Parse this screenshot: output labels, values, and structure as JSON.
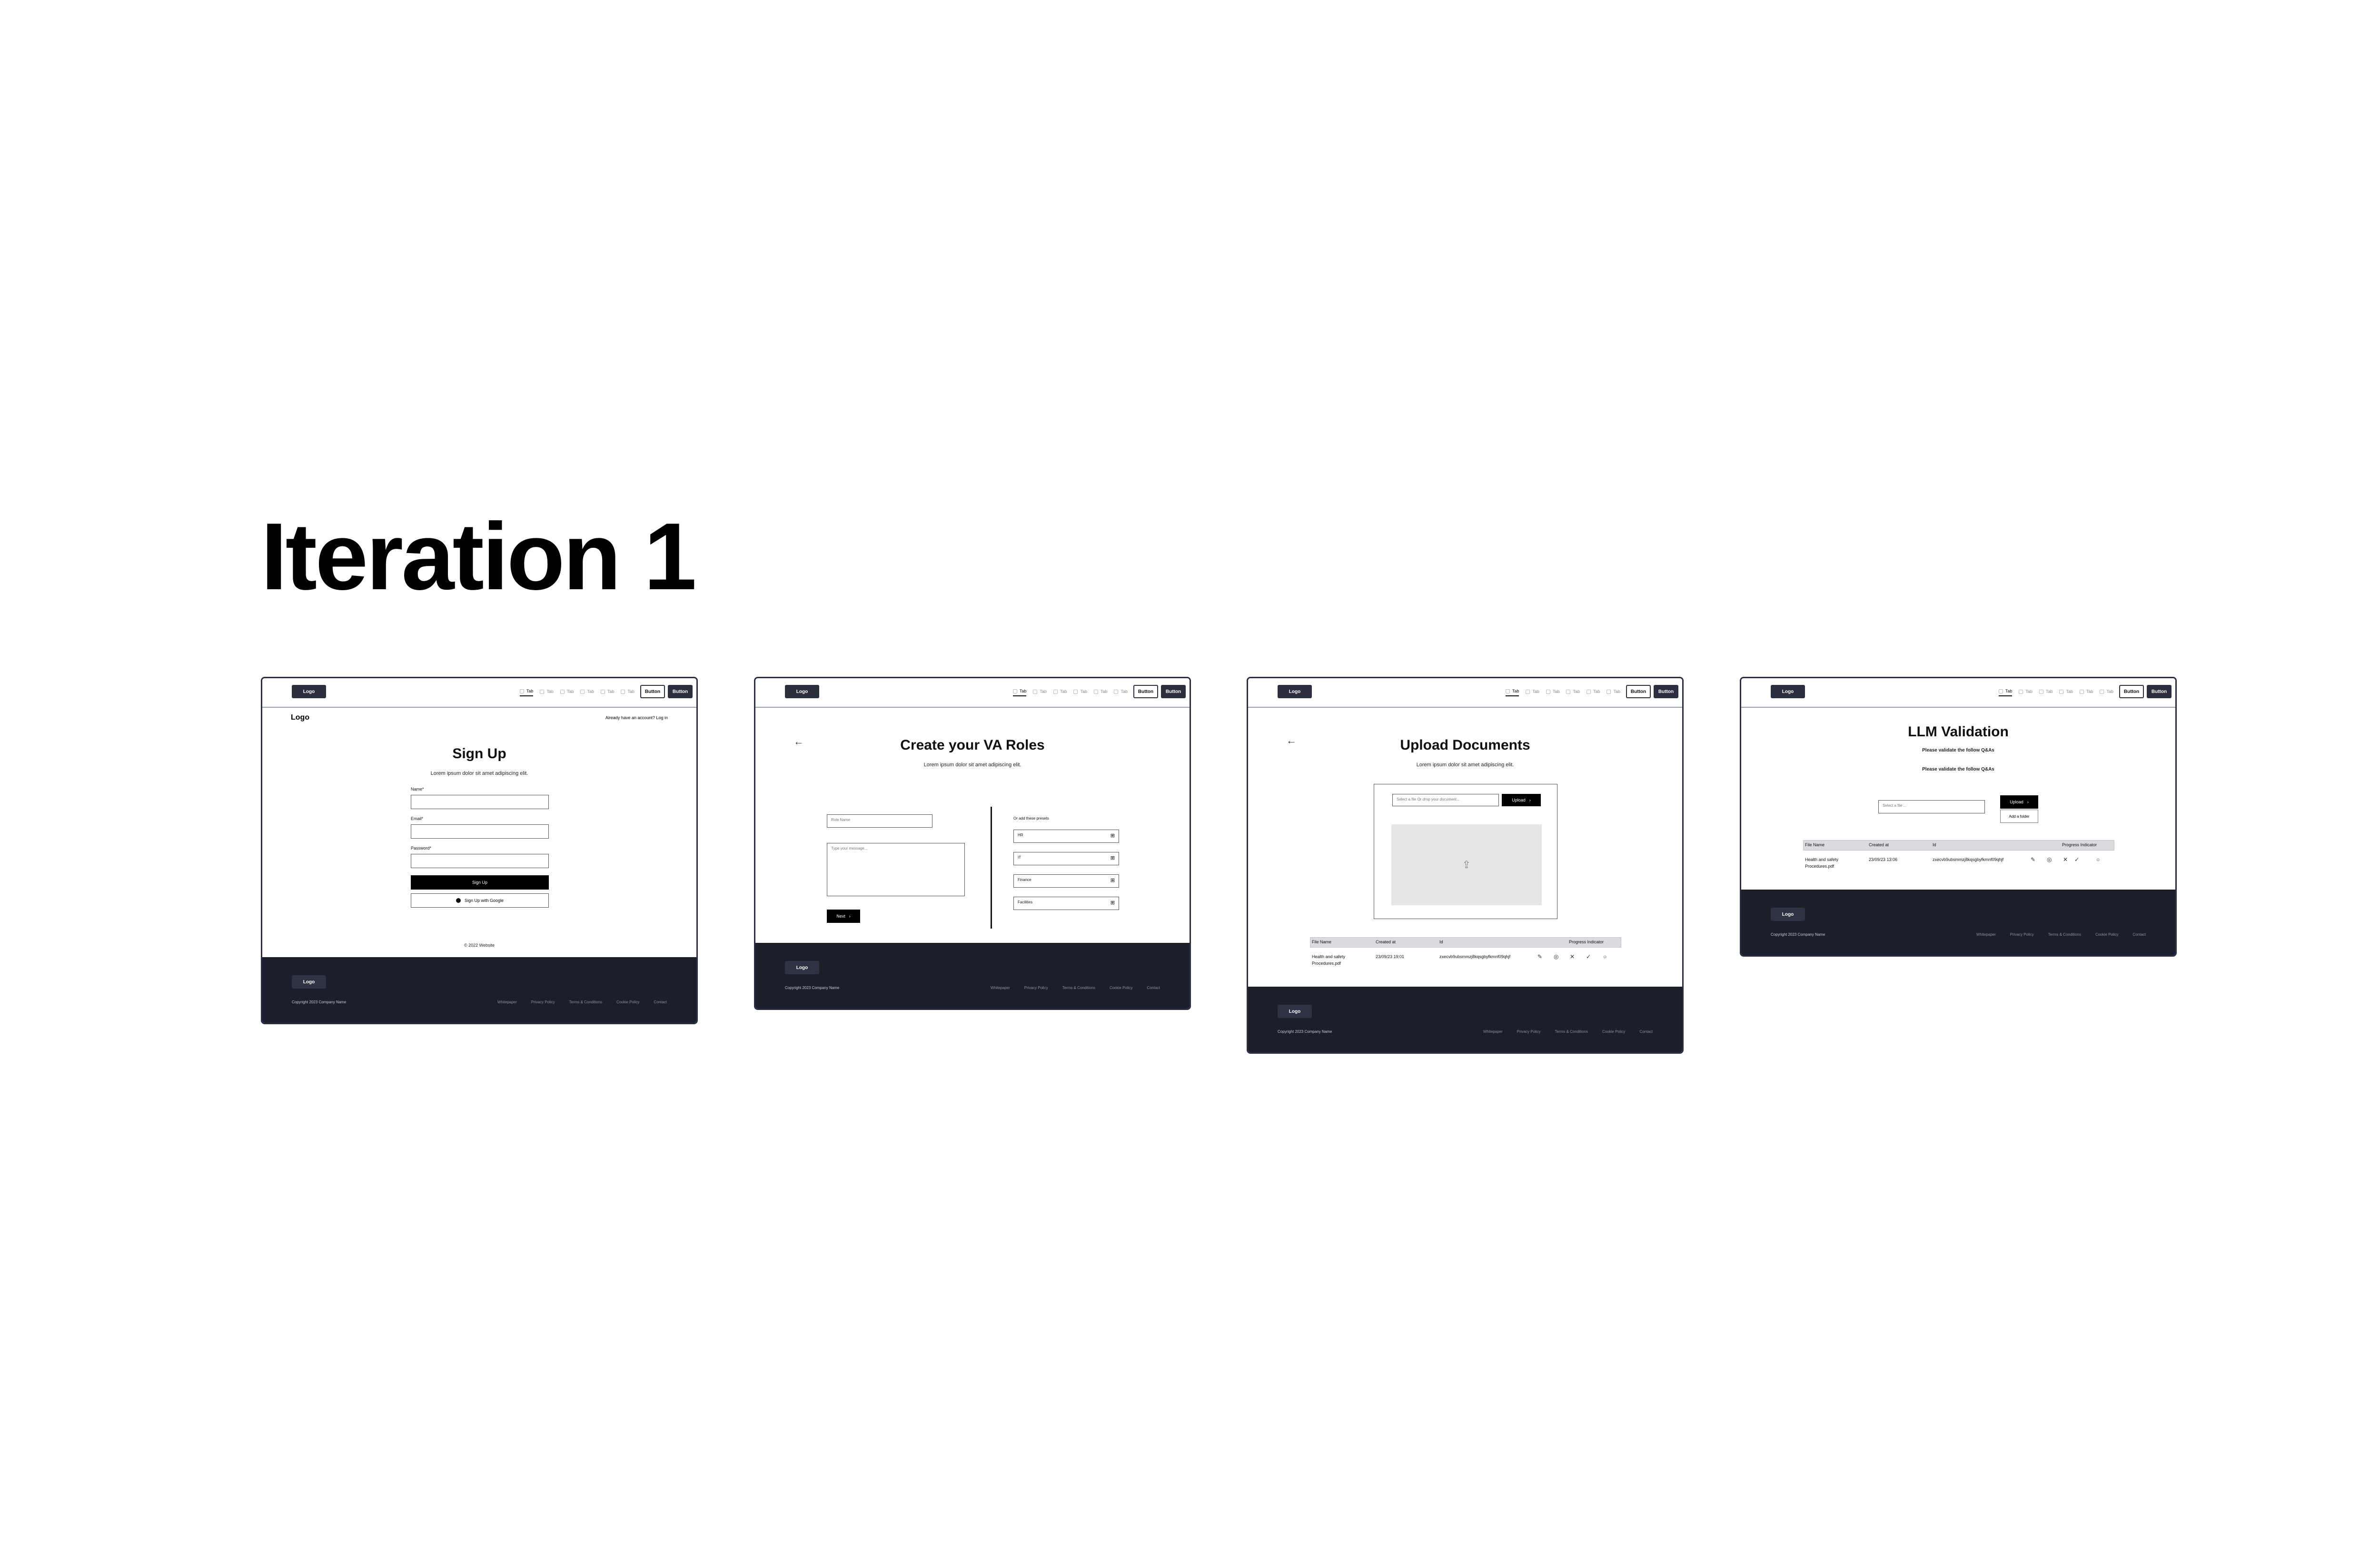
{
  "title": "Iteration 1",
  "header": {
    "logo": "Logo",
    "tabs": [
      "Tab",
      "Tab",
      "Tab",
      "Tab",
      "Tab",
      "Tab"
    ],
    "button_outline": "Button",
    "button_solid": "Button"
  },
  "footer": {
    "logo": "Logo",
    "copyright": "Copyright 2023 Company Name",
    "links": [
      "Whitepaper",
      "Privacy Policy",
      "Terms & Conditions",
      "Cookie Policy",
      "Contact"
    ]
  },
  "signup": {
    "brand": "Logo",
    "login_prompt": "Already have an account? Log in",
    "heading": "Sign Up",
    "subtitle": "Lorem ipsum dolor sit amet adipiscing elit.",
    "name_label": "Name*",
    "email_label": "Email*",
    "password_label": "Password*",
    "submit": "Sign Up",
    "google": "Sign Up with Google",
    "small_copyright": "© 2022 Website"
  },
  "roles": {
    "heading": "Create your VA Roles",
    "subtitle": "Lorem ipsum dolor sit amet adipiscing elit.",
    "role_placeholder": "Role Name",
    "message_placeholder": "Type your message...",
    "next": "Next",
    "presets_label": "Or add these presets",
    "presets": [
      "HR",
      "IT",
      "Finance",
      "Facilities"
    ]
  },
  "upload": {
    "heading": "Upload Documents",
    "subtitle": "Lorem ipsum dolor sit amet adipiscing elit.",
    "file_placeholder": "Select a file Or drop your document...",
    "upload_button": "Upload",
    "table_headers": [
      "File Name",
      "Created at",
      "Id",
      "Progress Indicator"
    ],
    "row": {
      "file_name_1": "Health and safety",
      "file_name_2": "Procedures.pdf",
      "created_at": "23/09/23 19:01",
      "id": "zxecvb9ubsmmzj8kqsgbyfkmnf09qhjf"
    }
  },
  "llm": {
    "heading": "LLM Validation",
    "line1": "Please validate the follow Q&As",
    "line2": "Please validate the follow Q&As",
    "file_placeholder": "Select a file ...",
    "upload_button": "Upload",
    "add_folder": "Add a folder",
    "table_headers": [
      "File Name",
      "Created at",
      "Id",
      "Progress Indicator"
    ],
    "row": {
      "file_name_1": "Health and safety",
      "file_name_2": "Procedures.pdf",
      "created_at": "23/09/23 13:06",
      "id": "zxecvb9ubsmmzj8kqsgbyfkmnf09qhjf"
    }
  }
}
